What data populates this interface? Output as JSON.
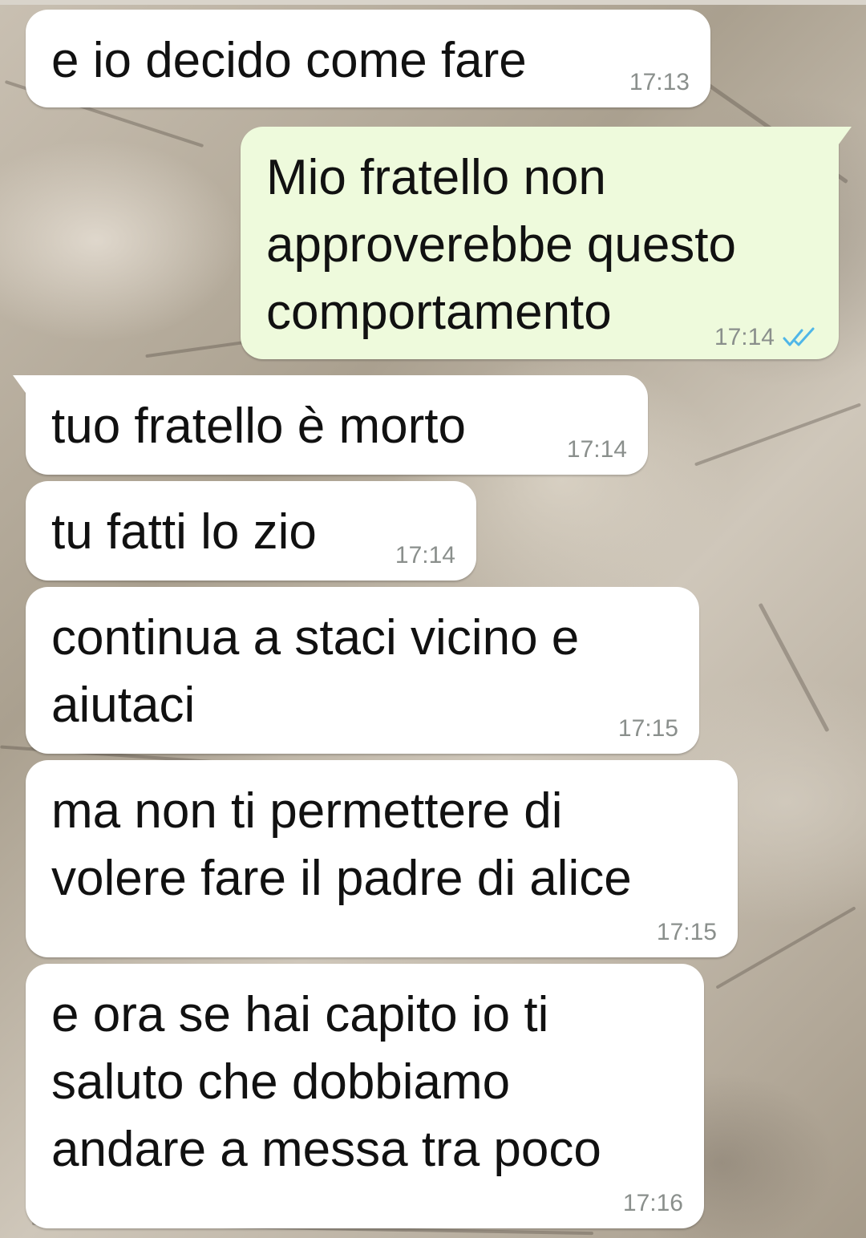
{
  "chat": {
    "colors": {
      "incoming_bubble": "#ffffff",
      "outgoing_bubble": "#eefadc",
      "text": "#111111",
      "timestamp": "#8a8f8c",
      "read_ticks": "#4fb6e8"
    },
    "messages": [
      {
        "direction": "incoming",
        "text": "e io decido come fare",
        "time": "17:13"
      },
      {
        "direction": "outgoing",
        "text": "Mio fratello non\napproverebbe questo\ncomportamento",
        "time": "17:14",
        "status_icon": "double-check-icon"
      },
      {
        "direction": "incoming",
        "text": "tuo fratello è morto",
        "time": "17:14"
      },
      {
        "direction": "incoming",
        "text": "tu fatti lo zio",
        "time": "17:14"
      },
      {
        "direction": "incoming",
        "text": "continua a staci vicino e\naiutaci",
        "time": "17:15"
      },
      {
        "direction": "incoming",
        "text": "ma non ti permettere di\nvolere fare il padre di alice",
        "time": "17:15"
      },
      {
        "direction": "incoming",
        "text": "e ora se hai capito io ti\nsaluto che dobbiamo\nandare a messa tra poco",
        "time": "17:16"
      }
    ]
  }
}
